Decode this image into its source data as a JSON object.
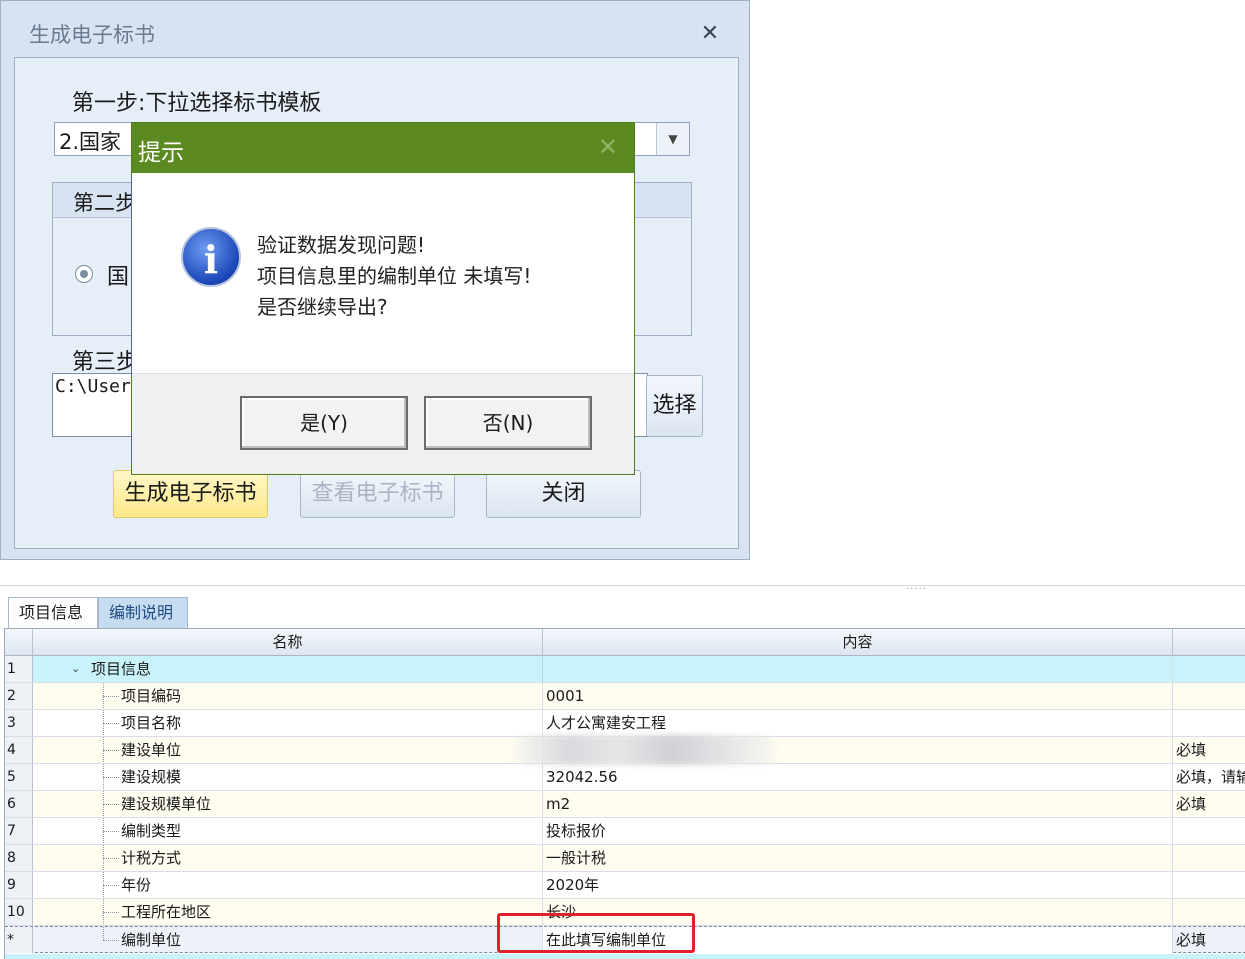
{
  "window": {
    "title": "生成电子标书",
    "step1_label": "第一步:下拉选择标书模板",
    "template_value": "2.国家",
    "step2_label": "第二步",
    "radio_label": "国",
    "step3_label": "第三步",
    "path_value": "C:\\User",
    "choose_label": "选择",
    "generate_label": "生成电子标书",
    "view_label": "查看电子标书",
    "close_label": "关闭"
  },
  "dialog": {
    "title": "提示",
    "line1": "验证数据发现问题!",
    "line2": "项目信息里的编制单位 未填写!",
    "line3": "是否继续导出?",
    "yes_label": "是(Y)",
    "no_label": "否(N)"
  },
  "panel": {
    "tabs": [
      {
        "label": "项目信息"
      },
      {
        "label": "编制说明"
      }
    ],
    "columns": {
      "name": "名称",
      "content": "内容"
    },
    "rows": [
      {
        "num": "1",
        "name": "项目信息",
        "value": "",
        "req": ""
      },
      {
        "num": "2",
        "name": "项目编码",
        "value": "0001",
        "req": ""
      },
      {
        "num": "3",
        "name": "项目名称",
        "value": "人才公寓建安工程",
        "req": ""
      },
      {
        "num": "4",
        "name": "建设单位",
        "value": "",
        "req": "必填"
      },
      {
        "num": "5",
        "name": "建设规模",
        "value": "32042.56",
        "req": "必填，请输"
      },
      {
        "num": "6",
        "name": "建设规模单位",
        "value": "m2",
        "req": "必填"
      },
      {
        "num": "7",
        "name": "编制类型",
        "value": "投标报价",
        "req": ""
      },
      {
        "num": "8",
        "name": "计税方式",
        "value": "一般计税",
        "req": ""
      },
      {
        "num": "9",
        "name": "年份",
        "value": "2020年",
        "req": ""
      },
      {
        "num": "10",
        "name": "工程所在地区",
        "value": "长沙",
        "req": ""
      },
      {
        "num": "*",
        "name": "编制单位",
        "value": "在此填写编制单位",
        "req": "必填"
      }
    ]
  }
}
